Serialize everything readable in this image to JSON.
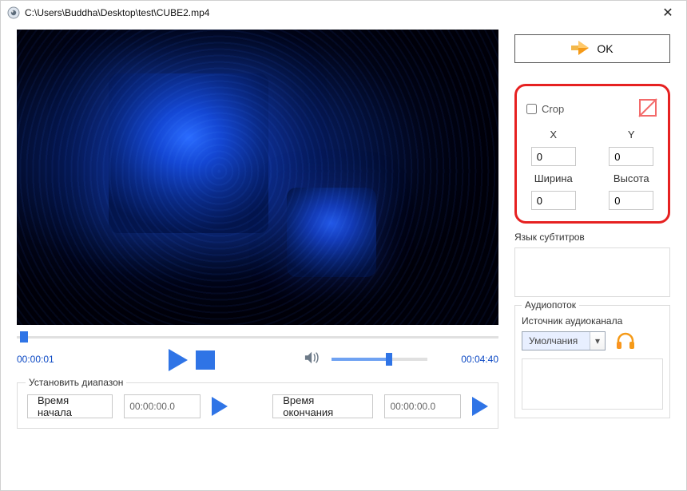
{
  "title": "C:\\Users\\Buddha\\Desktop\\test\\CUBE2.mp4",
  "ok_label": "OK",
  "crop": {
    "checkbox_label": "Crop",
    "x_label": "X",
    "y_label": "Y",
    "width_label": "Ширина",
    "height_label": "Высота",
    "x": "0",
    "y": "0",
    "width": "0",
    "height": "0"
  },
  "subs": {
    "label": "Язык субтитров"
  },
  "audio": {
    "group_label": "Аудиопоток",
    "source_label": "Источник аудиоканала",
    "selected": "Умолчания"
  },
  "playback": {
    "current": "00:00:01",
    "total": "00:04:40"
  },
  "range": {
    "group_label": "Установить диапазон",
    "start_btn": "Время начала",
    "end_btn": "Время окончания",
    "start_value": "00:00:00.0",
    "end_value": "00:00:00.0"
  }
}
